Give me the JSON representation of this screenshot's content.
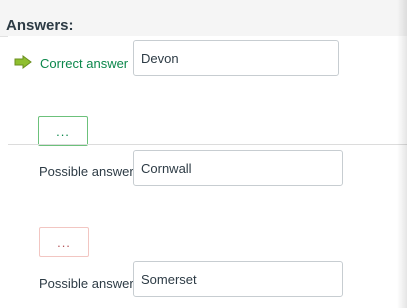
{
  "header": {
    "title": "Answers:"
  },
  "correct": {
    "icon": "arrow-right-icon",
    "label": "Correct answer",
    "value": "Devon",
    "more": "..."
  },
  "possible": [
    {
      "label": "Possible answer",
      "value": "Cornwall",
      "more": "..."
    },
    {
      "label": "Possible answer",
      "value": "Somerset"
    }
  ],
  "colors": {
    "correct_green": "#0b874b",
    "arrow_fill": "#8fbf2f",
    "ellipsis_green_border": "#6cc17b",
    "ellipsis_red_border": "#f2c6c2"
  }
}
